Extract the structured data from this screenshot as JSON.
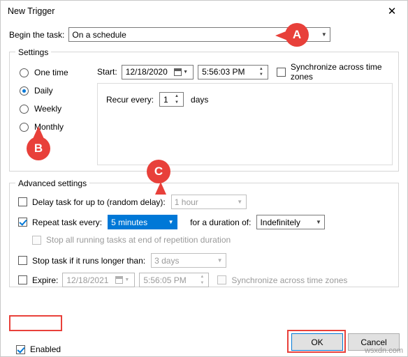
{
  "window": {
    "title": "New Trigger",
    "close_icon": "close-icon"
  },
  "begin": {
    "label": "Begin the task:",
    "value": "On a schedule"
  },
  "settings": {
    "legend": "Settings",
    "radios": [
      {
        "label": "One time",
        "checked": false
      },
      {
        "label": "Daily",
        "checked": true
      },
      {
        "label": "Weekly",
        "checked": false
      },
      {
        "label": "Monthly",
        "checked": false
      }
    ],
    "start_label": "Start:",
    "start_date": "12/18/2020",
    "start_time": "5:56:03 PM",
    "sync_label": "Synchronize across time zones",
    "recur_label": "Recur every:",
    "recur_value": "1",
    "recur_unit": "days"
  },
  "advanced": {
    "legend": "Advanced settings",
    "delay": {
      "label": "Delay task for up to (random delay):",
      "value": "1 hour",
      "checked": false
    },
    "repeat": {
      "label": "Repeat task every:",
      "value": "5 minutes",
      "checked": true,
      "duration_label": "for a duration of:",
      "duration_value": "Indefinitely"
    },
    "stop_all": {
      "label": "Stop all running tasks at end of repetition duration",
      "checked": false
    },
    "stop_longer": {
      "label": "Stop task if it runs longer than:",
      "value": "3 days",
      "checked": false
    },
    "expire": {
      "label": "Expire:",
      "date": "12/18/2021",
      "time": "5:56:05 PM",
      "sync_label": "Synchronize across time zones",
      "checked": false
    },
    "enabled": {
      "label": "Enabled",
      "checked": true
    }
  },
  "buttons": {
    "ok": "OK",
    "cancel": "Cancel"
  },
  "annotations": {
    "a": "A",
    "b": "B",
    "c": "C"
  },
  "watermark": "wsxdn.com"
}
